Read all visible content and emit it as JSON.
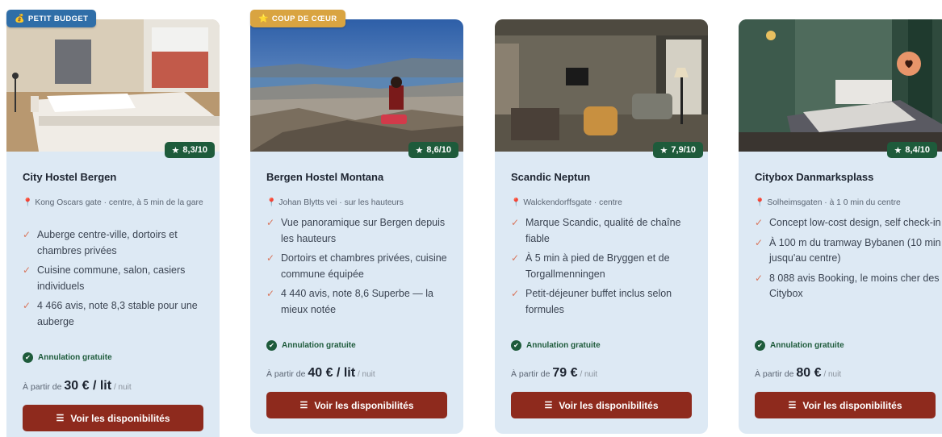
{
  "cards": [
    {
      "badge": "PETIT BUDGET",
      "badge_icon": "moneybag-icon",
      "rating": "8,3/10",
      "name": "City Hostel Bergen",
      "address": "Kong Oscars gate · centre, à  5  min de la gare",
      "features": [
        "Auberge centre-ville, dortoirs et chambres privées",
        "Cuisine commune, salon, casiers individuels",
        "4 466 avis, note 8,3 stable pour une auberge"
      ],
      "cancellation": "Annulation gratuite",
      "price_prefix": "À partir de",
      "price": "30 € / lit",
      "price_suffix": "/ nuit",
      "cta": "Voir les disponibilités"
    },
    {
      "badge": "COUP DE CŒUR",
      "badge_icon": "star-icon",
      "rating": "8,6/10",
      "name": "Bergen Hostel Montana",
      "address": "Johan Blytts vei · sur les hauteurs",
      "features": [
        "Vue panoramique sur Bergen depuis les hauteurs",
        "Dortoirs et chambres privées, cuisine commune équipée",
        "4 440 avis, note 8,6 Superbe — la mieux notée"
      ],
      "cancellation": "Annulation gratuite",
      "price_prefix": "À partir de",
      "price": "40 € / lit",
      "price_suffix": "/ nuit",
      "cta": "Voir les disponibilités"
    },
    {
      "rating": "7,9/10",
      "name": "Scandic Neptun",
      "address": "Walckendorffsgate · centre",
      "features": [
        "Marque Scandic, qualité de chaîne fiable",
        "À 5 min à pied de Bryggen et de Torgallmenningen",
        "Petit-déjeuner buffet inclus selon formules"
      ],
      "cancellation": "Annulation gratuite",
      "price_prefix": "À partir de",
      "price": "79 €",
      "price_suffix": "/ nuit",
      "cta": "Voir les disponibilités"
    },
    {
      "rating": "8,4/10",
      "name": "Citybox Danmarksplass",
      "address": "Solheimsgaten · à  1  0  min du centre",
      "features": [
        "Concept low-cost design, self check-in",
        "À 100 m du tramway Bybanen (10 min jusqu'au centre)",
        "8 088 avis Booking, le moins cher des Citybox"
      ],
      "cancellation": "Annulation gratuite",
      "price_prefix": "À partir de",
      "price": "80 €",
      "price_suffix": "/ nuit",
      "cta": "Voir les disponibilités",
      "favorite_icon": "heart-icon"
    }
  ],
  "colors": {
    "card_bg": "#dde9f4",
    "badge_blue": "#2f6ea8",
    "badge_gold": "#d9a441",
    "rating_green": "#1e5b3b",
    "cta_red": "#8e2a1d",
    "check_orange": "#d8775e"
  }
}
